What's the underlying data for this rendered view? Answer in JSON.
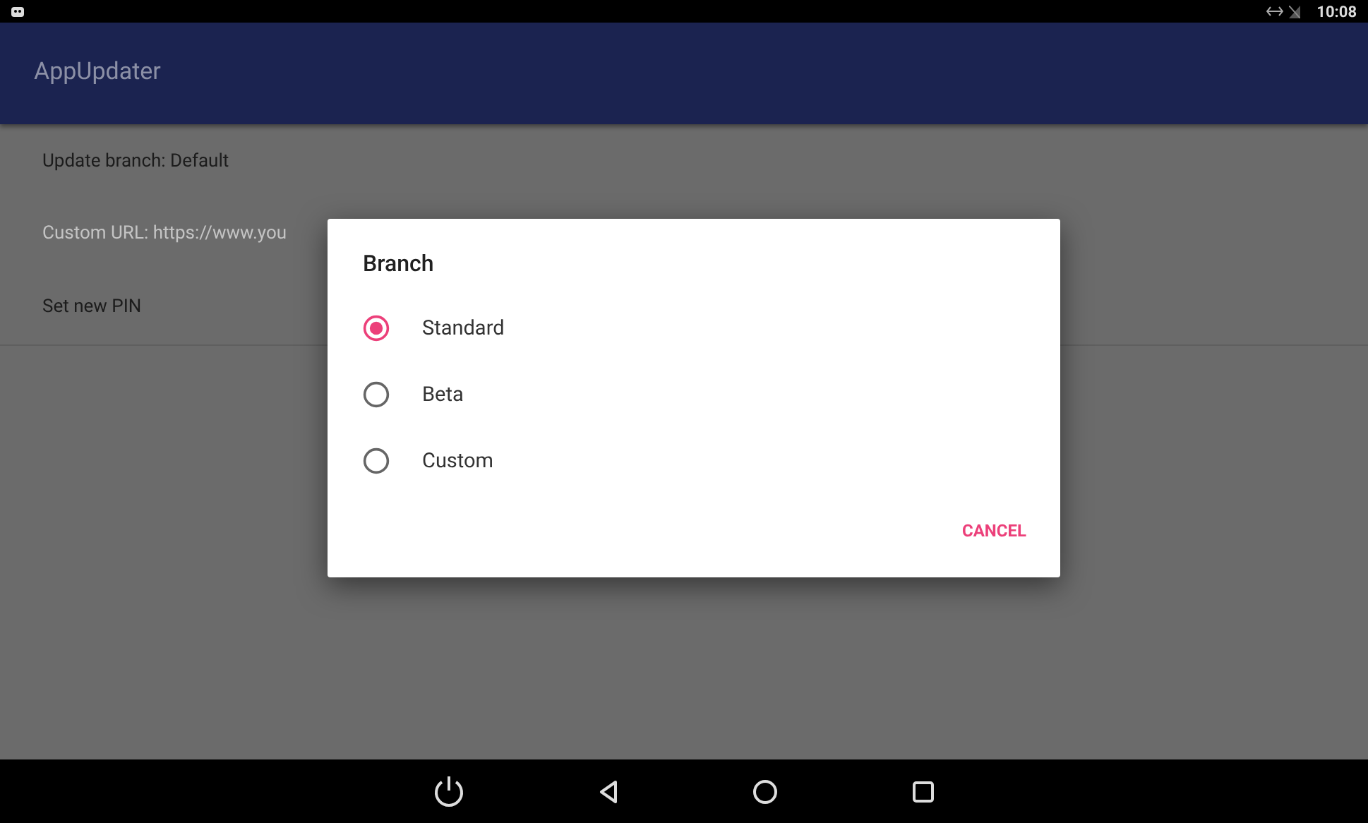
{
  "status_bar": {
    "time": "10:08"
  },
  "app_bar": {
    "title": "AppUpdater"
  },
  "settings": [
    {
      "label": "Update branch: Default",
      "disabled": false
    },
    {
      "label": "Custom URL: https://www.you",
      "disabled": true
    },
    {
      "label": "Set new PIN",
      "disabled": false
    }
  ],
  "dialog": {
    "title": "Branch",
    "options": [
      {
        "label": "Standard",
        "selected": true
      },
      {
        "label": "Beta",
        "selected": false
      },
      {
        "label": "Custom",
        "selected": false
      }
    ],
    "buttons": [
      "CANCEL"
    ]
  }
}
